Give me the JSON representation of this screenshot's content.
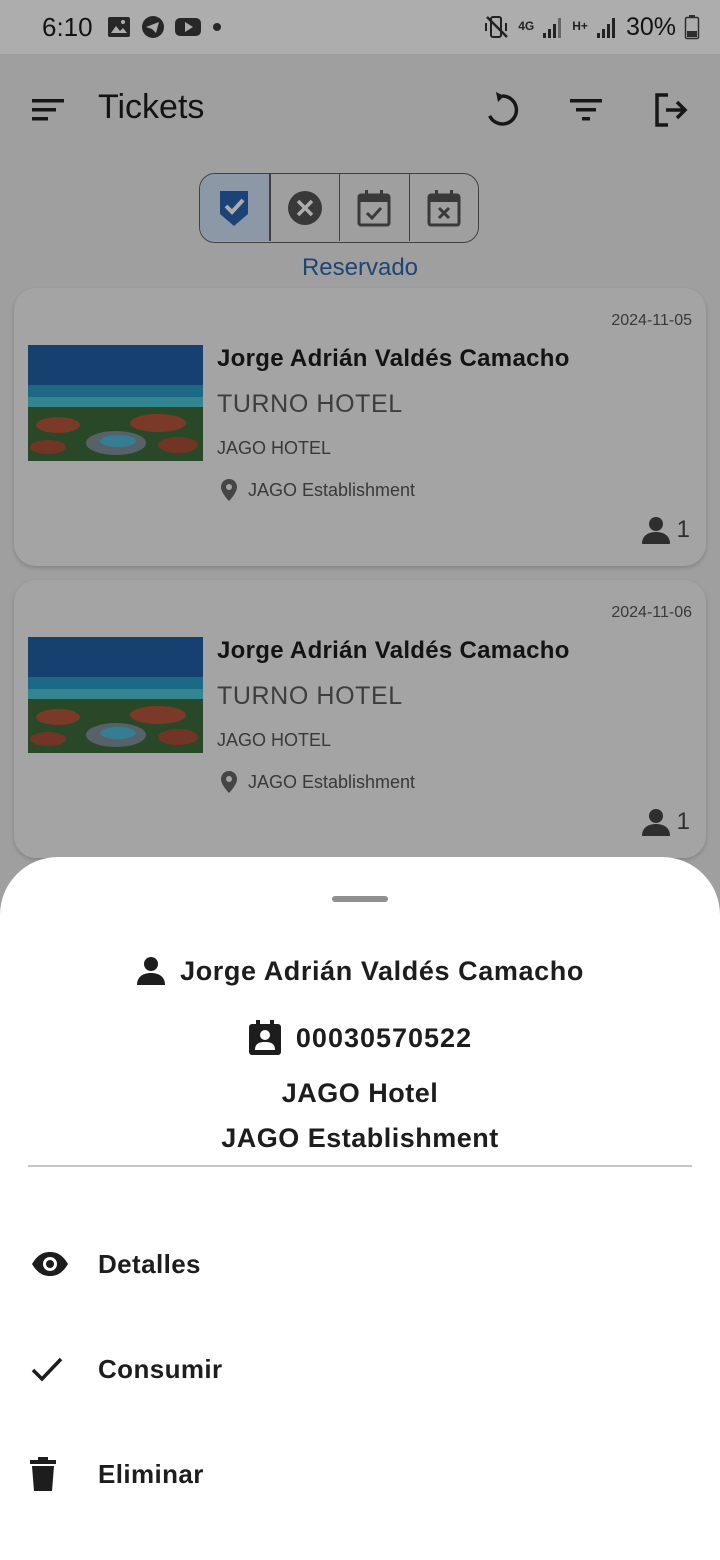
{
  "status_bar": {
    "time": "6:10",
    "battery_pct": "30%",
    "network_4g": "4G",
    "network_hplus": "H+",
    "left_icons": [
      "gallery-icon",
      "telegram-icon",
      "youtube-icon",
      "dot-icon"
    ],
    "right_icons": [
      "mute-vibrate-icon",
      "signal-icon",
      "signal-icon",
      "battery-icon"
    ]
  },
  "app_bar": {
    "title": "Tickets",
    "actions": [
      "refresh-icon",
      "filter-icon",
      "logout-icon"
    ]
  },
  "filter_tabs": {
    "icons": [
      "reserved-check-icon",
      "cancelled-icon",
      "calendar-check-icon",
      "calendar-x-icon"
    ],
    "selected_index": 0,
    "selected_label": "Reservado"
  },
  "tickets": [
    {
      "date": "2024-11-05",
      "name": "Jorge Adrián Valdés Camacho",
      "service": "TURNO HOTEL",
      "hotel": "JAGO HOTEL",
      "location": "JAGO Establishment",
      "people": "1"
    },
    {
      "date": "2024-11-06",
      "name": "Jorge Adrián Valdés Camacho",
      "service": "TURNO HOTEL",
      "hotel": "JAGO HOTEL",
      "location": "JAGO Establishment",
      "people": "1"
    }
  ],
  "sheet": {
    "name": "Jorge Adrián Valdés Camacho",
    "id_number": "00030570522",
    "hotel": "JAGO Hotel",
    "establishment": "JAGO Establishment",
    "actions": [
      {
        "label": "Detalles",
        "icon": "eye-icon"
      },
      {
        "label": "Consumir",
        "icon": "check-icon"
      },
      {
        "label": "Eliminar",
        "icon": "trash-icon"
      }
    ]
  },
  "colors": {
    "accent": "#2f66a8",
    "selected_tab_bg": "#cfe0f5",
    "scrim": "rgba(0,0,0,0.32)"
  }
}
